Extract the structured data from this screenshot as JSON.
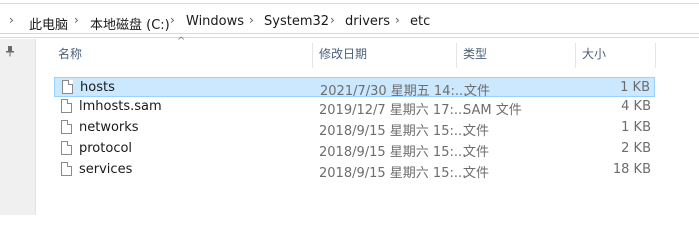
{
  "breadcrumb": {
    "items": [
      "此电脑",
      "本地磁盘 (C:)",
      "Windows",
      "System32",
      "drivers",
      "etc"
    ],
    "separator": "›"
  },
  "header": {
    "name": "名称",
    "date": "修改日期",
    "type": "类型",
    "size": "大小",
    "sort_indicator": "^"
  },
  "files": [
    {
      "name": "hosts",
      "date": "2021/7/30 星期五 14:...",
      "type": "文件",
      "size": "1 KB",
      "selected": true
    },
    {
      "name": "lmhosts.sam",
      "date": "2019/12/7 星期六 17:...",
      "type": "SAM 文件",
      "size": "4 KB",
      "selected": false
    },
    {
      "name": "networks",
      "date": "2018/9/15 星期六 15:...",
      "type": "文件",
      "size": "1 KB",
      "selected": false
    },
    {
      "name": "protocol",
      "date": "2018/9/15 星期六 15:...",
      "type": "文件",
      "size": "2 KB",
      "selected": false
    },
    {
      "name": "services",
      "date": "2018/9/15 星期六 15:...",
      "type": "文件",
      "size": "18 KB",
      "selected": false
    }
  ],
  "colors": {
    "selection_bg": "#cce8ff",
    "selection_border": "#99d1ff",
    "header_text": "#4c607a"
  },
  "icons": {
    "nav_arrow": "chevron-right-icon",
    "pin": "pin-icon",
    "file": "file-icon"
  }
}
